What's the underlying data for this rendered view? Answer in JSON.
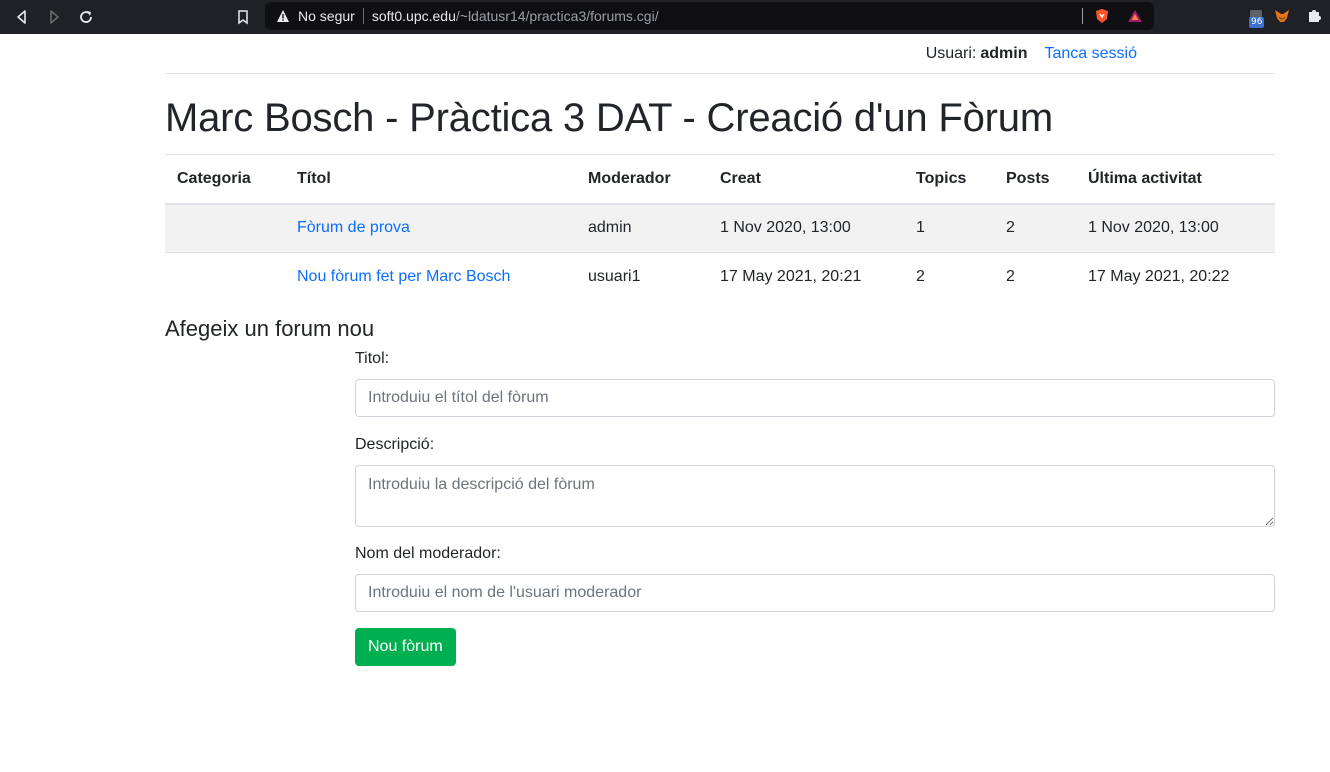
{
  "browser": {
    "security_label": "No segur",
    "url_host": "soft0.upc.edu",
    "url_path": "/~ldatusr14/practica3/forums.cgi/",
    "extension_badge": "96"
  },
  "userbar": {
    "label": "Usuari:",
    "username": "admin",
    "logout": "Tanca sessió"
  },
  "page_title": "Marc Bosch - Pràctica 3 DAT - Creació d'un Fòrum",
  "table": {
    "headers": [
      "Categoria",
      "Títol",
      "Moderador",
      "Creat",
      "Topics",
      "Posts",
      "Última activitat"
    ],
    "rows": [
      {
        "categoria": "",
        "titol": "Fòrum de prova",
        "moderador": "admin",
        "creat": "1 Nov 2020, 13:00",
        "topics": "1",
        "posts": "2",
        "ultima": "1 Nov 2020, 13:00"
      },
      {
        "categoria": "",
        "titol": "Nou fòrum fet per Marc Bosch",
        "moderador": "usuari1",
        "creat": "17 May 2021, 20:21",
        "topics": "2",
        "posts": "2",
        "ultima": "17 May 2021, 20:22"
      }
    ]
  },
  "form": {
    "heading": "Afegeix un forum nou",
    "title_label": "Titol:",
    "title_placeholder": "Introduiu el títol del fòrum",
    "title_value": "",
    "desc_label": "Descripció:",
    "desc_placeholder": "Introduiu la descripció del fòrum",
    "desc_value": "",
    "mod_label": "Nom del moderador:",
    "mod_placeholder": "Introduiu el nom de l'usuari moderador",
    "mod_value": "",
    "submit_label": "Nou fòrum"
  },
  "colors": {
    "link": "#0d6efd",
    "submit": "#00b050",
    "chrome": "#202124"
  }
}
